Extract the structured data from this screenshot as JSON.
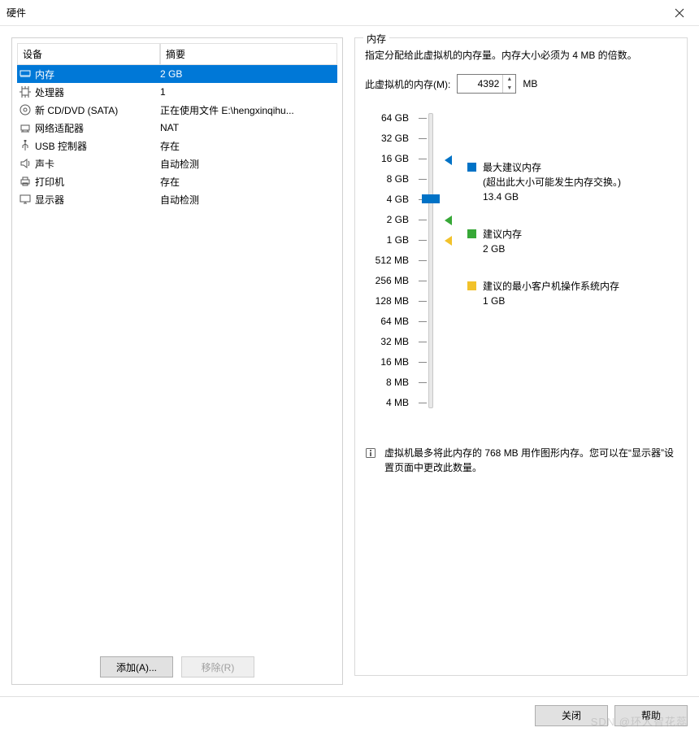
{
  "title": "硬件",
  "columns": {
    "device": "设备",
    "summary": "摘要"
  },
  "devices": [
    {
      "icon": "memory",
      "name": "内存",
      "summary": "2 GB",
      "selected": true
    },
    {
      "icon": "cpu",
      "name": "处理器",
      "summary": "1"
    },
    {
      "icon": "disc",
      "name": "新 CD/DVD (SATA)",
      "summary": "正在使用文件 E:\\hengxinqihu..."
    },
    {
      "icon": "network",
      "name": "网络适配器",
      "summary": "NAT"
    },
    {
      "icon": "usb",
      "name": "USB 控制器",
      "summary": "存在"
    },
    {
      "icon": "sound",
      "name": "声卡",
      "summary": "自动检测"
    },
    {
      "icon": "printer",
      "name": "打印机",
      "summary": "存在"
    },
    {
      "icon": "display",
      "name": "显示器",
      "summary": "自动检测"
    }
  ],
  "buttons": {
    "add": "添加(A)...",
    "remove": "移除(R)",
    "close": "关闭",
    "help": "帮助"
  },
  "memory": {
    "group_label": "内存",
    "description": "指定分配给此虚拟机的内存量。内存大小必须为 4 MB 的倍数。",
    "label": "此虚拟机的内存(M):",
    "value": "4392",
    "unit": "MB",
    "ticks": [
      "64 GB",
      "32 GB",
      "16 GB",
      "8 GB",
      "4 GB",
      "2 GB",
      "1 GB",
      "512 MB",
      "256 MB",
      "128 MB",
      "64 MB",
      "32 MB",
      "16 MB",
      "8 MB",
      "4 MB"
    ],
    "legend": {
      "max": {
        "title": "最大建议内存",
        "note": "(超出此大小可能发生内存交换。)",
        "value": "13.4 GB",
        "color": "#0072c6"
      },
      "rec": {
        "title": "建议内存",
        "value": "2 GB",
        "color": "#37a837"
      },
      "min": {
        "title": "建议的最小客户机操作系统内存",
        "value": "1 GB",
        "color": "#f2c22b"
      }
    },
    "note": "虚拟机最多将此内存的 768 MB 用作图形内存。您可以在“显示器”设置页面中更改此数量。"
  },
  "watermark": "SDN @环人智花蕊"
}
